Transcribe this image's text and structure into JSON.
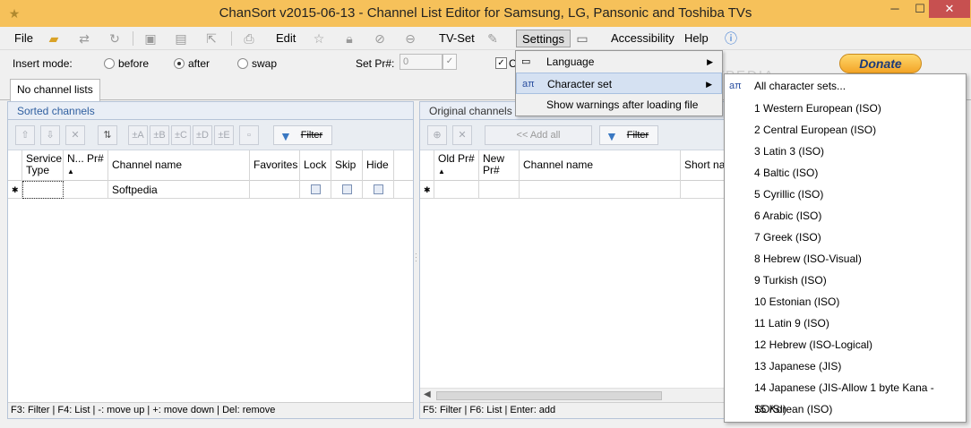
{
  "window": {
    "title": "ChanSort v2015-06-13 - Channel List Editor for Samsung, LG, Pansonic and Toshiba TVs",
    "min_glyph": "─",
    "max_glyph": "☐",
    "close_glyph": "✕"
  },
  "menubar": {
    "file": "File",
    "edit": "Edit",
    "tvset": "TV-Set",
    "settings": "Settings",
    "accessibility": "Accessibility",
    "help": "Help"
  },
  "options": {
    "insert_mode_label": "Insert mode:",
    "before": "before",
    "after": "after",
    "swap": "swap",
    "set_pr_label": "Set Pr#:",
    "set_pr_value": "0",
    "check_c_label": "C",
    "donate": "Donate"
  },
  "tabs": {
    "no_channel_lists": "No channel lists"
  },
  "left_panel": {
    "title": "Sorted channels",
    "filter": "Filter",
    "tool_labels": [
      "±A",
      "±B",
      "±C",
      "±D",
      "±E"
    ],
    "columns": [
      "Service Type",
      "N... Pr#",
      "Channel name",
      "Favorites",
      "Lock",
      "Skip",
      "Hide"
    ],
    "row": {
      "name": "Softpedia"
    },
    "status": "F3: Filter | F4: List | -: move up | +: move down | Del: remove"
  },
  "right_panel": {
    "title": "Original channels",
    "add_all": "<< Add all",
    "filter": "Filter",
    "columns": [
      "Old Pr#",
      "New Pr#",
      "Channel name",
      "Short nar"
    ],
    "status": "F5: Filter | F6: List | Enter: add"
  },
  "settings_menu": {
    "items": [
      "Language",
      "Character set",
      "Show warnings after loading file"
    ]
  },
  "charset_menu": {
    "items": [
      "All character sets...",
      "1 Western European (ISO)",
      "2 Central European (ISO)",
      "3 Latin 3 (ISO)",
      "4 Baltic (ISO)",
      "5 Cyrillic (ISO)",
      "6 Arabic (ISO)",
      "7 Greek (ISO)",
      "8 Hebrew (ISO-Visual)",
      "9 Turkish (ISO)",
      "10 Estonian (ISO)",
      "11 Latin 9 (ISO)",
      "12 Hebrew (ISO-Logical)",
      "13 Japanese (JIS)",
      "14 Japanese (JIS-Allow 1 byte Kana - SO/SI)",
      "15 Korean (ISO)"
    ]
  },
  "watermark": "SOFTPEDIA",
  "colors": {
    "titlebar": "#f6c15a",
    "close_button": "#c75050",
    "panel_title": "#2f5fa0",
    "menu_highlight": "#d5e1f2"
  },
  "icons": {
    "app": "tv-icon",
    "open": "folder-open-icon",
    "save": "save-icon",
    "print": "printer-icon",
    "favorite": "star-icon",
    "lock": "lock-icon",
    "skip": "skip-icon",
    "hide": "hide-icon",
    "tvset": "wrench-icon",
    "chat": "speech-bubble-icon",
    "help": "help-icon"
  }
}
